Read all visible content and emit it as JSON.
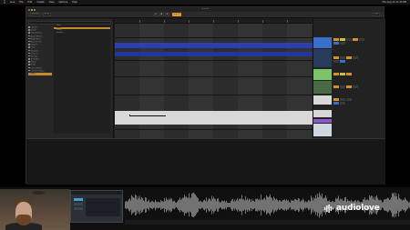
{
  "menubar": {
    "items": [
      "Live",
      "File",
      "Edit",
      "Create",
      "View",
      "Options",
      "Help"
    ],
    "clock": "Thu Aug 10 11:35 PM"
  },
  "window": {
    "title": "Untitled"
  },
  "controlbar": {
    "tempo": "120.00",
    "meter": "4 / 4",
    "position": "1. 1. 1",
    "cpu": "3 %"
  },
  "browser": {
    "places": [
      "Sounds",
      "Drums",
      "Instruments",
      "Audio Effects",
      "MIDI Effects",
      "Max for Live",
      "Plug-ins",
      "Clips",
      "Samples",
      "Grooves",
      "Tunings",
      "Templates",
      "Places",
      "Packs",
      "User Library",
      "Current Project",
      "Splice"
    ],
    "selected_place": "Splice",
    "files": [
      "Name",
      "Folder",
      "Project",
      "Samples"
    ]
  },
  "watermark": {
    "text": "audiolove"
  },
  "colors": {
    "accent": "#e29b2f",
    "clip_blue": "#2a3fb0",
    "clip_white": "#d8d8d8",
    "mixer_green": "#7cc36a",
    "mixer_purple": "#8a5bc9",
    "mixer_blue": "#3a6fc9"
  }
}
